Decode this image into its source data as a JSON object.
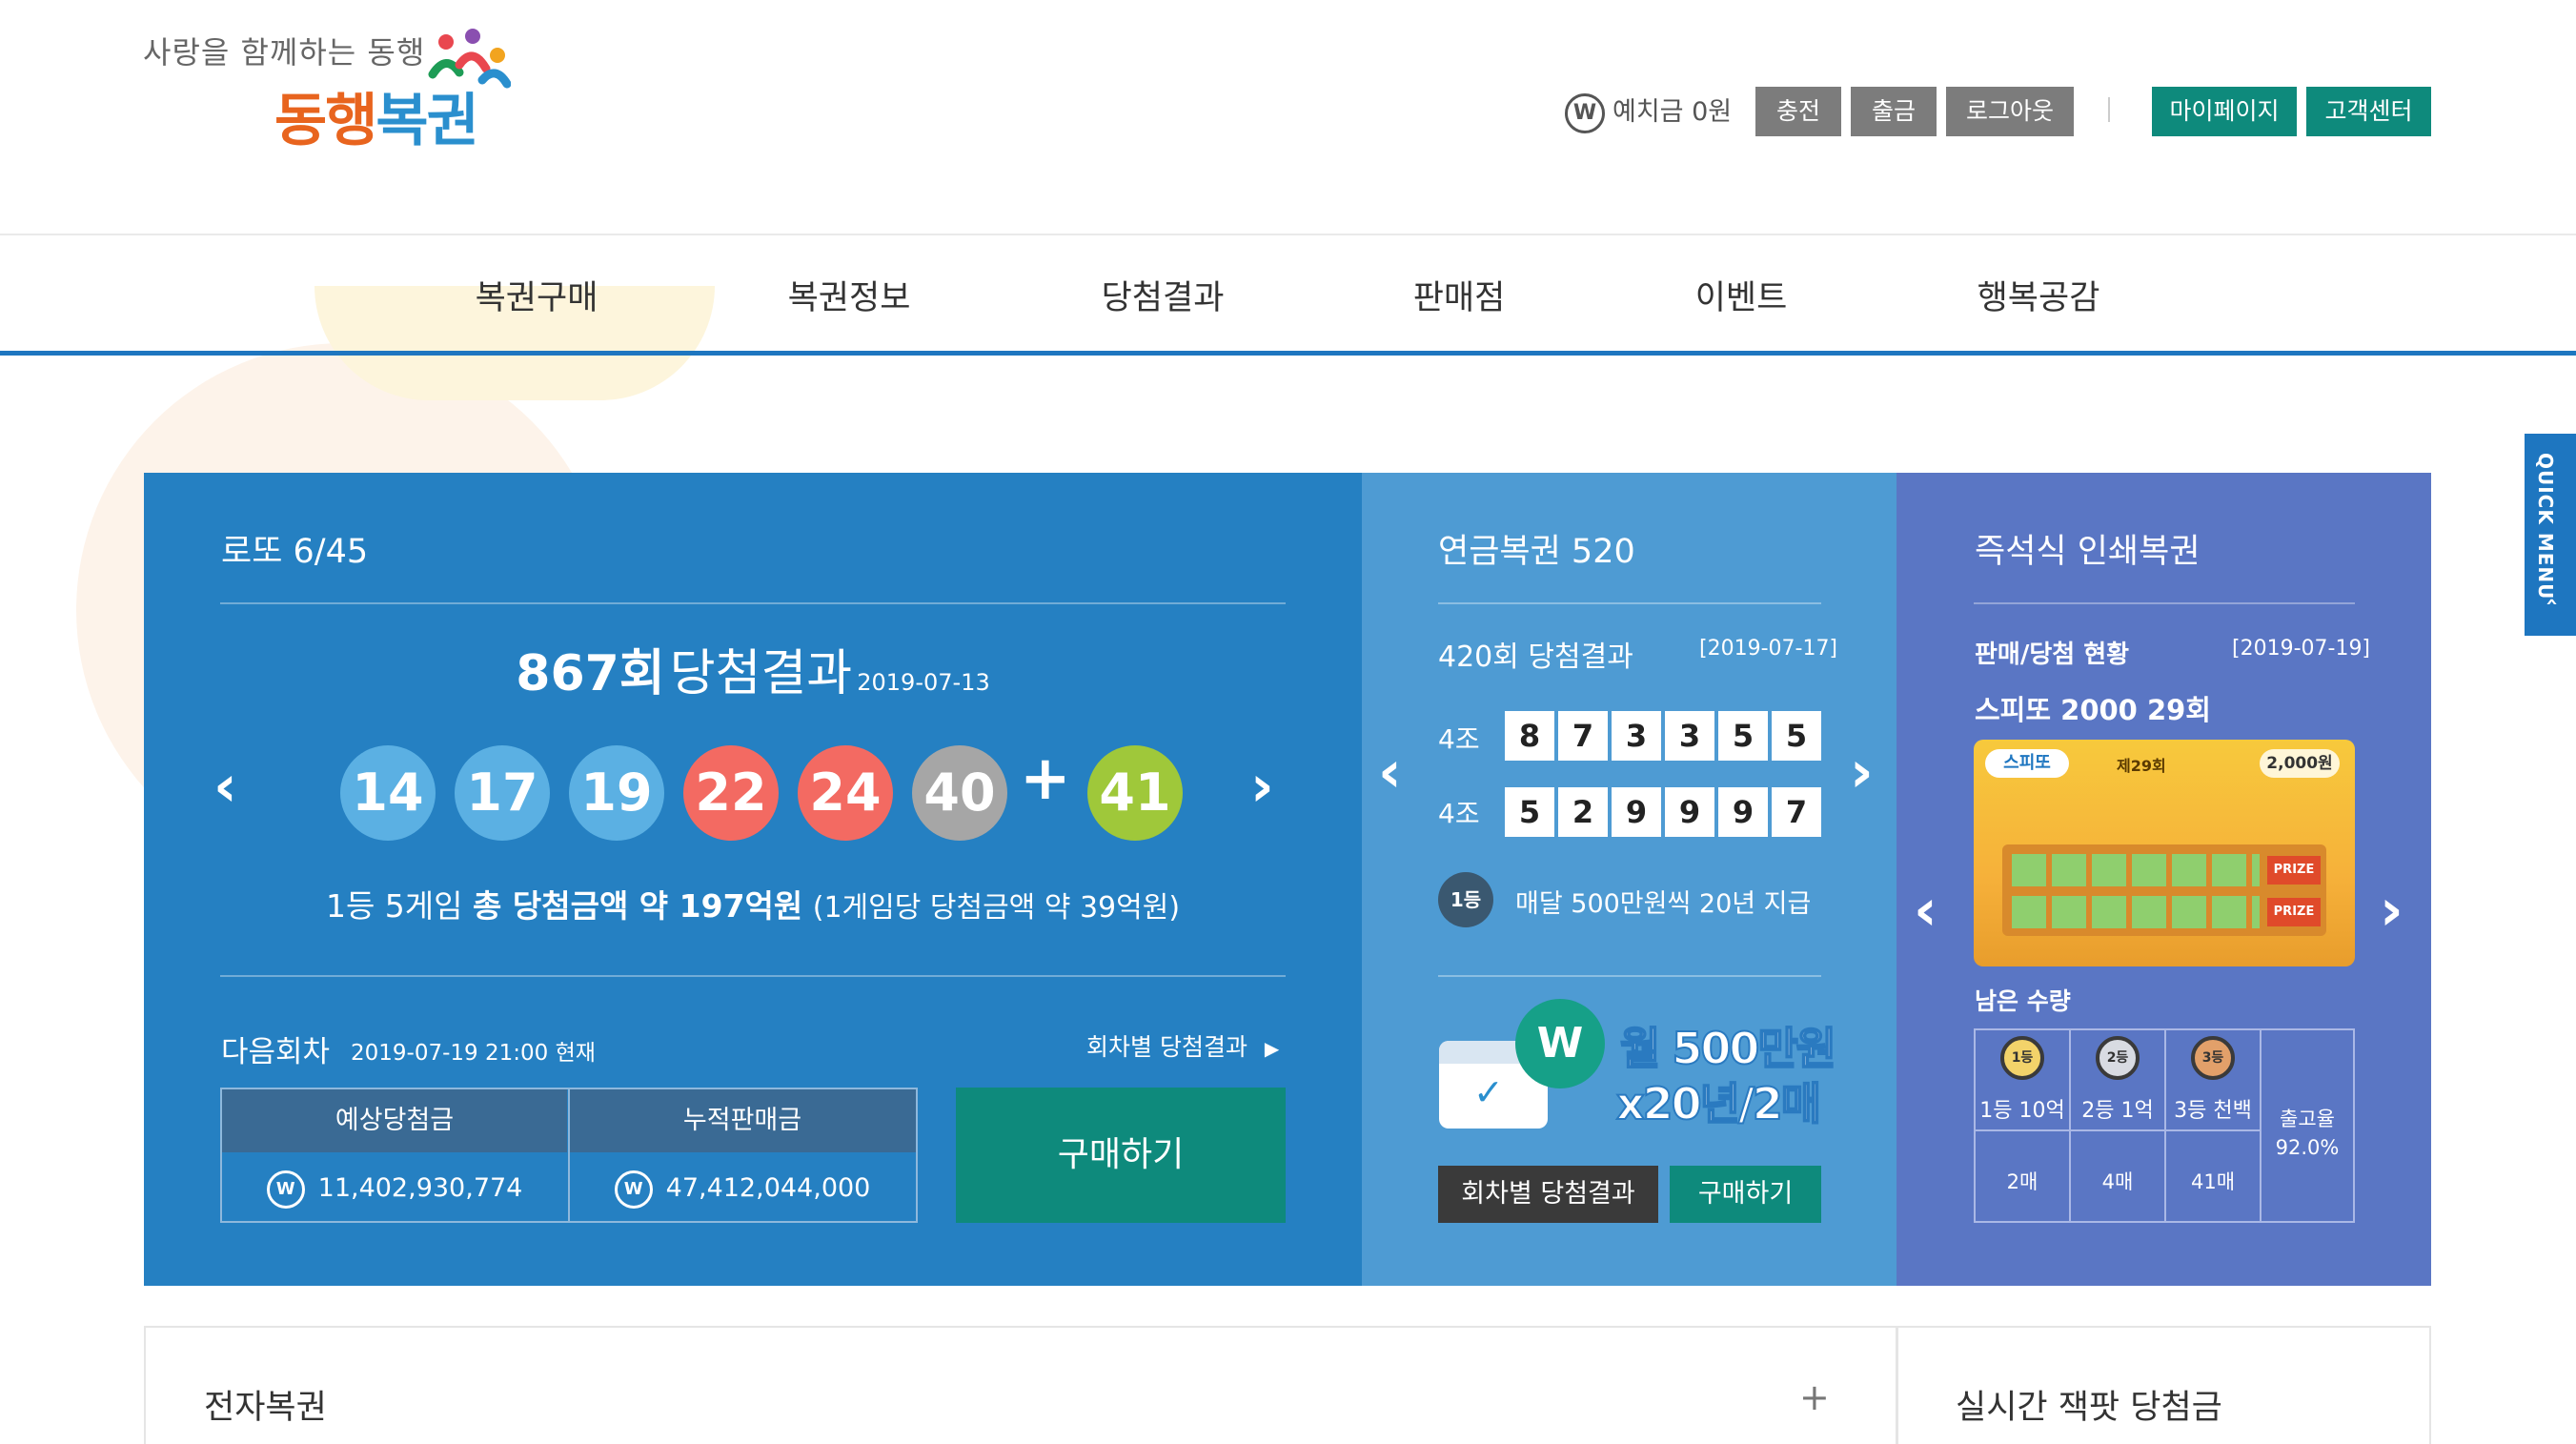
{
  "header": {
    "logo_tagline": "사랑을 함께하는 동행",
    "logo_name_a": "동행",
    "logo_name_b": "복권",
    "currency_icon": "W",
    "deposit_label": "예치금",
    "deposit_value": "0원",
    "buttons": {
      "charge": "충전",
      "withdraw": "출금",
      "logout": "로그아웃",
      "mypage": "마이페이지",
      "support": "고객센터"
    }
  },
  "nav": [
    "복권구매",
    "복권정보",
    "당첨결과",
    "판매점",
    "이벤트",
    "행복공감"
  ],
  "quick_menu": "QUICK MENU",
  "lotto": {
    "title": "로또 6/45",
    "round_label": "867회",
    "result_label": "당첨결과",
    "date": "2019-07-13",
    "numbers": [
      "14",
      "17",
      "19",
      "22",
      "24",
      "40"
    ],
    "bonus": "41",
    "plus": "+",
    "prize_prefix": "1등 5게임",
    "prize_bold": "총 당첨금액 약 197억원",
    "prize_suffix": "(1게임당 당첨금액 약 39억원)",
    "next_label": "다음회차",
    "next_time": "2019-07-19 21:00 현재",
    "history_link": "회차별 당첨결과",
    "table_headers": [
      "예상당첨금",
      "누적판매금"
    ],
    "table_values": [
      "11,402,930,774",
      "47,412,044,000"
    ],
    "buy_button": "구매하기",
    "colors": {
      "panel": "#2580c2",
      "ball_blue": "#5bb0e3",
      "ball_red": "#f36a62",
      "ball_gray": "#a6a6a6",
      "ball_green": "#9fc83a"
    }
  },
  "pension": {
    "title": "연금복권 520",
    "round": "420회 당첨결과",
    "date": "[2019-07-17]",
    "rows": [
      {
        "group": "4조",
        "digits": [
          "8",
          "7",
          "3",
          "3",
          "5",
          "5"
        ]
      },
      {
        "group": "4조",
        "digits": [
          "5",
          "2",
          "9",
          "9",
          "9",
          "7"
        ]
      }
    ],
    "rank_badge": "1등",
    "rank_text": "매달 500만원씩 20년 지급",
    "promo_line1": "월 500만원",
    "promo_line2": "x20년/2매",
    "promo_icon": "W",
    "history_button": "회차별 당첨결과",
    "buy_button": "구매하기"
  },
  "instant": {
    "title": "즉석식 인쇄복권",
    "status_label": "판매/당첨 현황",
    "date": "[2019-07-19]",
    "game_name": "스피또 2000 29회",
    "ticket_brand": "스피또",
    "ticket_round": "제29회",
    "ticket_price": "2,000원",
    "ticket_prize": "PRIZE",
    "remaining_label": "남은 수량",
    "medals": [
      {
        "badge": "1등",
        "label": "1등 10억",
        "count": "2매"
      },
      {
        "badge": "2등",
        "label": "2등 1억",
        "count": "4매"
      },
      {
        "badge": "3등",
        "label": "3등 천백",
        "count": "41매"
      }
    ],
    "release_label": "출고율",
    "release_value": "92.0%"
  },
  "bottom": {
    "left_title": "전자복권",
    "left_plus": "+",
    "right_title": "실시간 잭팟 당첨금"
  }
}
